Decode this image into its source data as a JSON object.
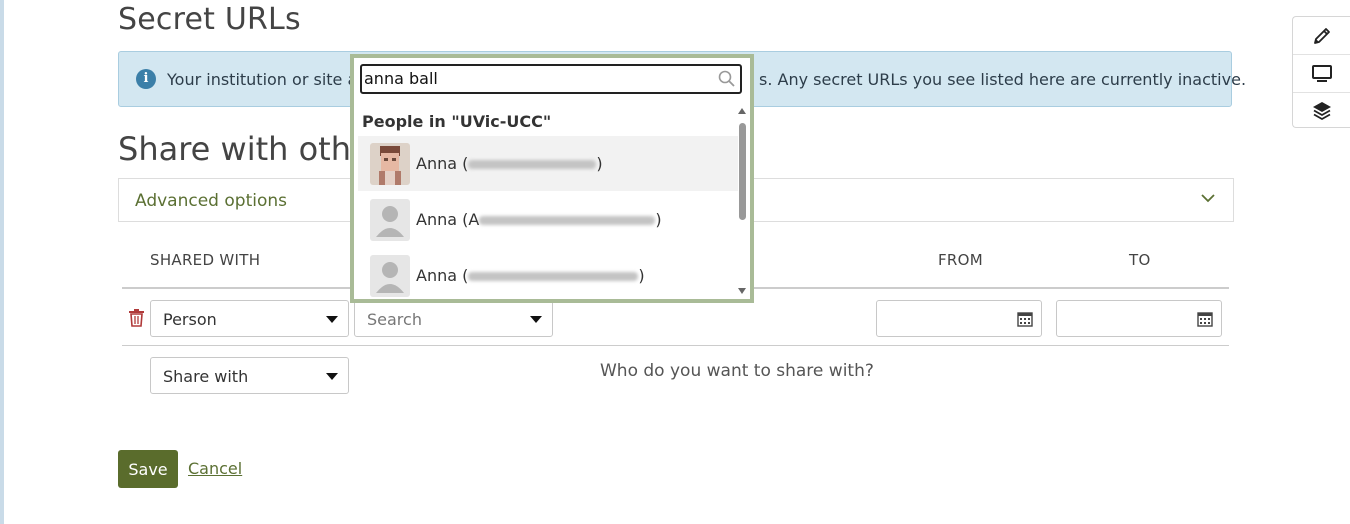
{
  "page": {
    "title": "Secret URLs"
  },
  "info": {
    "text_start": "Your institution or site ad",
    "text_end": "s. Any secret URLs you see listed here are currently inactive."
  },
  "share": {
    "heading": "Share with other",
    "advanced_options_label": "Advanced options"
  },
  "table": {
    "headers": {
      "shared_with": "SHARED WITH",
      "from": "FROM",
      "to": "TO"
    },
    "row": {
      "type_value": "Person",
      "search_placeholder": "Search"
    },
    "new_row": {
      "share_with_label": "Share with",
      "hint": "Who do you want to share with?"
    }
  },
  "actions": {
    "save_label": "Save",
    "cancel_label": "Cancel"
  },
  "dropdown": {
    "search_value": "anna ball",
    "group_label": "People in \"UVic-UCC\"",
    "items": [
      {
        "first_name": "Anna (",
        "closing": ")"
      },
      {
        "first_name": "Anna (A",
        "closing": ")"
      },
      {
        "first_name": "Anna (",
        "closing": ")"
      }
    ]
  },
  "side_tools": [
    "pencil-icon",
    "monitor-icon",
    "layers-icon"
  ],
  "colors": {
    "accent": "#5a6c2c",
    "link": "#5b7033",
    "info_bg": "#d3e7f1",
    "dropdown_border": "#a9bb97",
    "delete": "#b03a3a"
  }
}
